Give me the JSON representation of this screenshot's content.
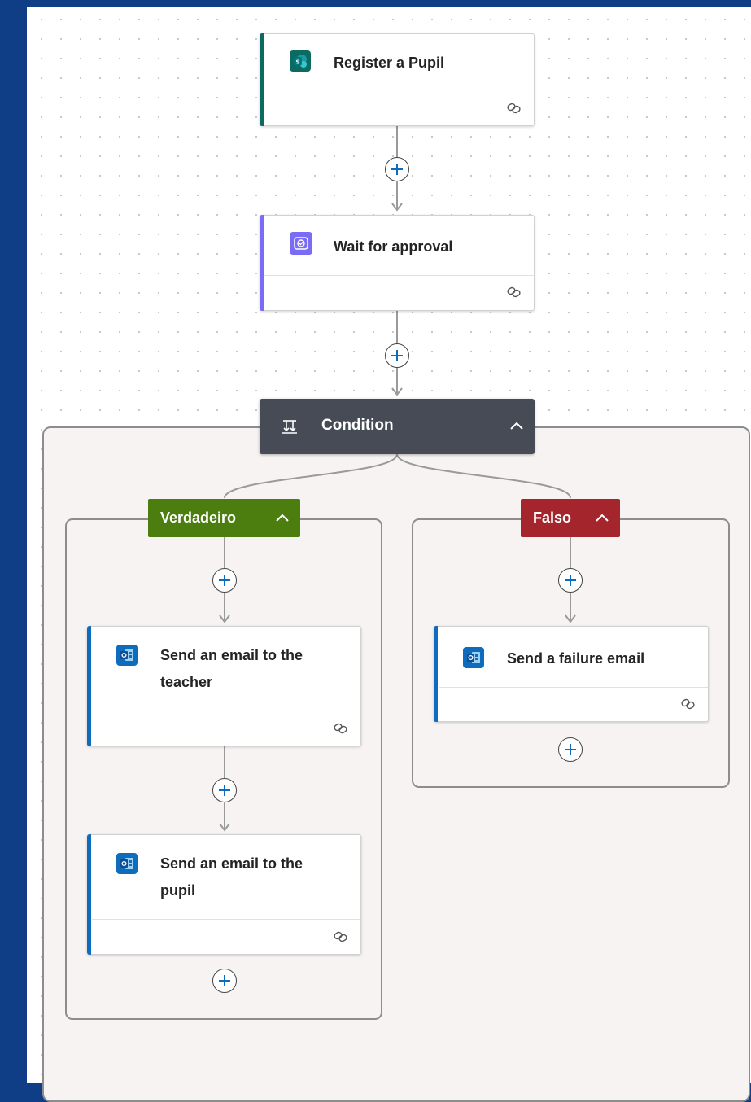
{
  "flow": {
    "trigger": {
      "title": "Register a Pupil",
      "connector_icon": "sharepoint-icon",
      "accent": "#0b6a62"
    },
    "approval": {
      "title": "Wait for approval",
      "connector_icon": "approvals-icon",
      "accent": "#7b6cf6"
    },
    "condition": {
      "label": "Condition",
      "icon": "condition-icon",
      "header_color": "#464b56"
    },
    "branches": {
      "true": {
        "label": "Verdadeiro",
        "color": "#4b7d0f",
        "actions": [
          {
            "title_line1": "Send an email to the",
            "title_line2": "teacher",
            "connector_icon": "outlook-icon"
          },
          {
            "title_line1": "Send an email to the",
            "title_line2": "pupil",
            "connector_icon": "outlook-icon"
          }
        ]
      },
      "false": {
        "label": "Falso",
        "color": "#a4262c",
        "actions": [
          {
            "title": "Send a failure email",
            "connector_icon": "outlook-icon"
          }
        ]
      }
    },
    "action_accent": "#0f6cbd"
  }
}
